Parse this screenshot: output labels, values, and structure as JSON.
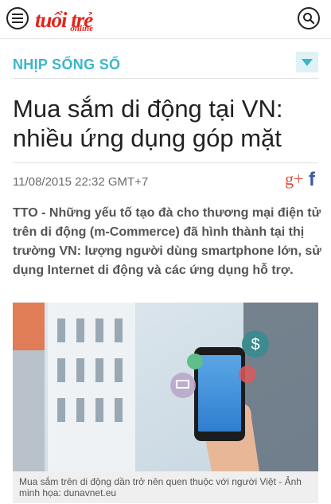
{
  "header": {
    "logo_main": "tuổi trẻ",
    "logo_sub": "online",
    "menu_icon": "hamburger-icon",
    "search_icon": "search-icon"
  },
  "section": {
    "title": "NHỊP SỐNG SỐ",
    "toggle_icon": "chevron-down-icon"
  },
  "article": {
    "headline": "Mua sắm di động tại VN: nhiều ứng dụng góp mặt",
    "datetime": "11/08/2015 22:32 GMT+7",
    "share": {
      "gplus_label": "g+",
      "facebook_label": "f"
    },
    "lead": "TTO - Những yếu tố tạo đà cho thương mại điện tử trên di động (m-Commerce) đã hình thành tại thị trường VN: lượng người dùng smartphone lớn, sử dụng Internet di động và các ứng dụng hỗ trợ.",
    "image_caption": "Mua sắm trên di động dần trở nên quen thuộc với người Việt - Ảnh minh họa: dunavnet.eu"
  },
  "colors": {
    "brand_red": "#e3241b",
    "section_teal": "#3bb6c9",
    "facebook_blue": "#3b5998",
    "gplus_red": "#dd4b39"
  }
}
